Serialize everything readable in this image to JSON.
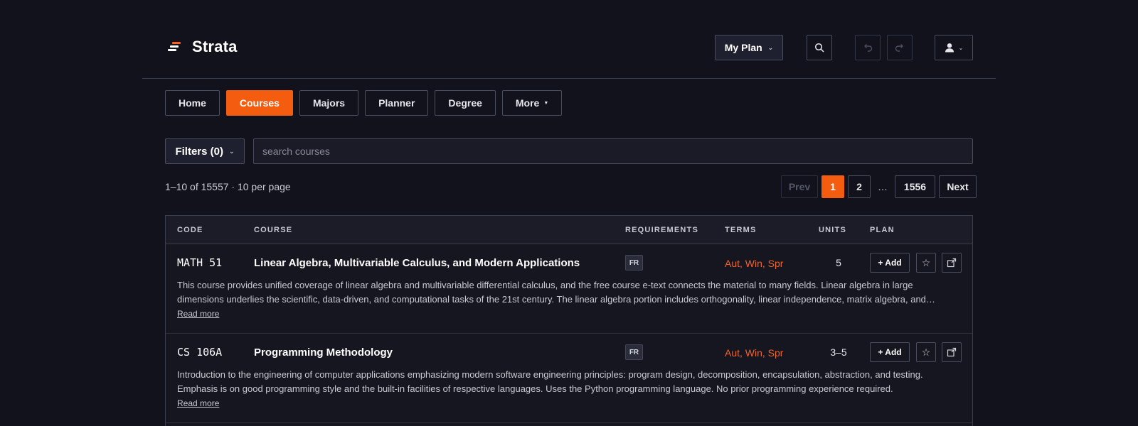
{
  "app": {
    "name": "Strata",
    "accent": "#f45d0f"
  },
  "header": {
    "plan_select": "My Plan",
    "icons": {
      "search": "search-icon",
      "undo": "undo-icon",
      "redo": "redo-icon",
      "user": "user-icon"
    }
  },
  "nav": {
    "tabs": [
      {
        "label": "Home"
      },
      {
        "label": "Courses",
        "active": true
      },
      {
        "label": "Majors"
      },
      {
        "label": "Planner"
      },
      {
        "label": "Degree"
      },
      {
        "label": "More"
      }
    ]
  },
  "filters": {
    "label": "Filters (0)",
    "search_placeholder": "search courses",
    "search_value": ""
  },
  "results": {
    "summary": "1–10 of 15557 · 10 per page",
    "pagination": {
      "prev": "Prev",
      "pages": [
        "1",
        "2"
      ],
      "ellipsis": "…",
      "last": "1556",
      "next": "Next",
      "current": "1"
    }
  },
  "table": {
    "headers": [
      "CODE",
      "COURSE",
      "REQUIREMENTS",
      "TERMS",
      "UNITS",
      "PLAN"
    ],
    "rows": [
      {
        "code": "MATH 51",
        "title": "Linear Algebra, Multivariable Calculus, and Modern Applications",
        "requirement": "FR",
        "terms": "Aut, Win, Spr",
        "units": "5",
        "add_label": "+ Add",
        "description": "This course provides unified coverage of linear algebra and multivariable differential calculus, and the free course e-text connects the material to many fields. Linear algebra in large dimensions underlies the scientific, data-driven, and computational tasks of the 21st century. The linear algebra portion includes orthogonality, linear independence, matrix algebra, and eigenvalues with applications.",
        "read_more": "Read more"
      },
      {
        "code": "CS 106A",
        "title": "Programming Methodology",
        "requirement": "FR",
        "terms": "Aut, Win, Spr",
        "units": "3–5",
        "add_label": "+ Add",
        "description": "Introduction to the engineering of computer applications emphasizing modern software engineering principles: program design, decomposition, encapsulation, abstraction, and testing. Emphasis is on good programming style and the built-in facilities of respective languages. Uses the Python programming language. No prior programming experience required.",
        "read_more": "Read more"
      }
    ]
  }
}
